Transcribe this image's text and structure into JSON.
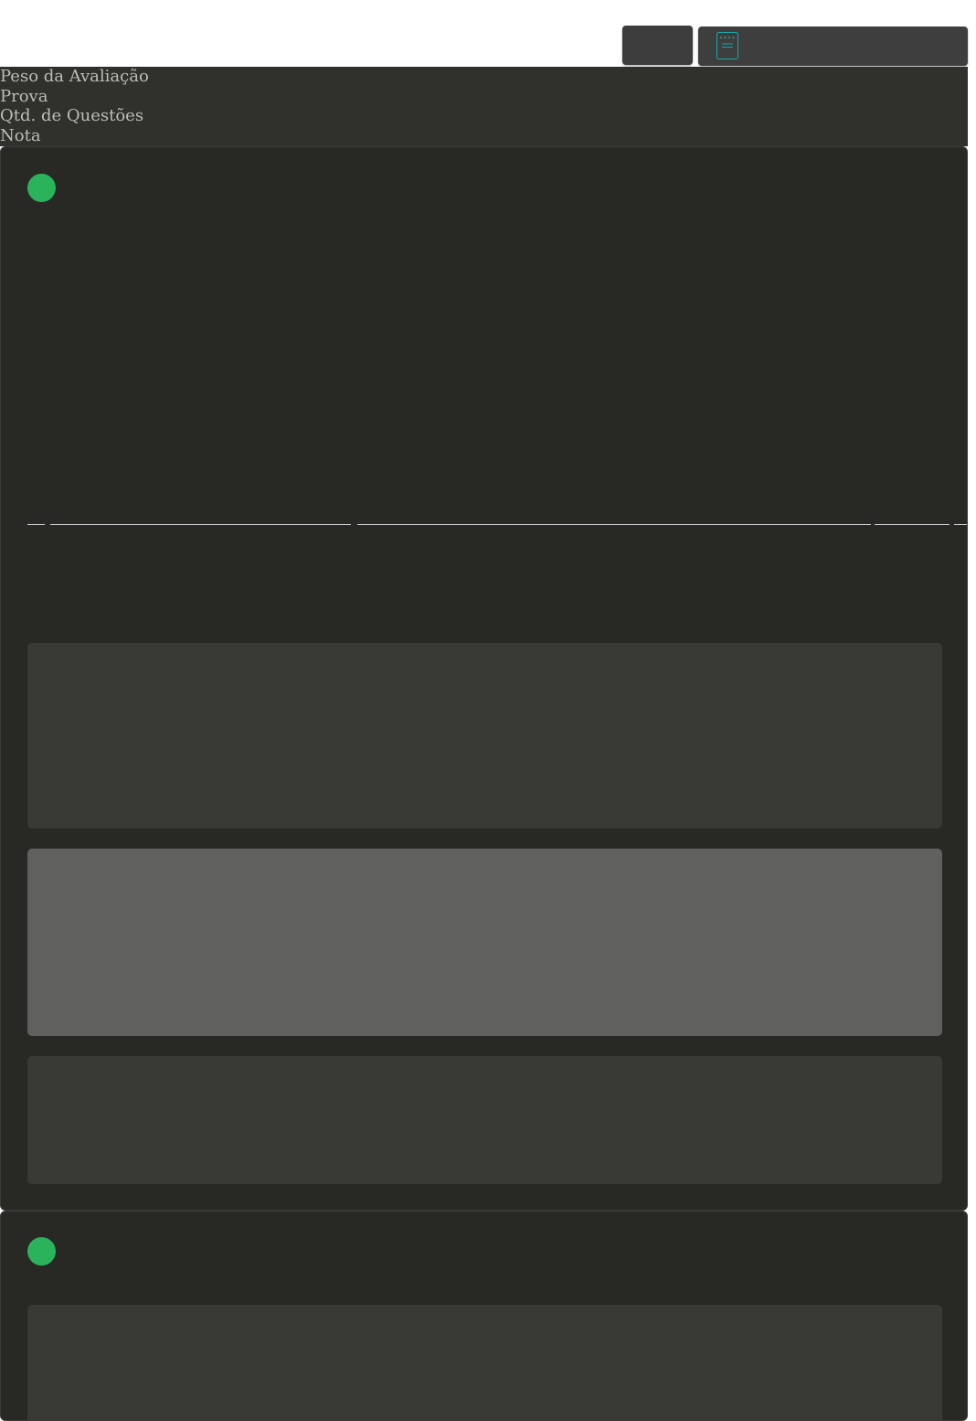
{
  "header": {
    "labels": [
      "Peso da Avaliação",
      "Prova",
      "Qtd. de Questões",
      "Nota"
    ]
  },
  "icons": {
    "toolbar_panel": "document-icon",
    "status": "status-dot"
  },
  "colors": {
    "status_ok": "#2bb35b",
    "document_icon": "#1aa6a6",
    "header_bg": "#30302c",
    "card_bg": "#282825"
  }
}
